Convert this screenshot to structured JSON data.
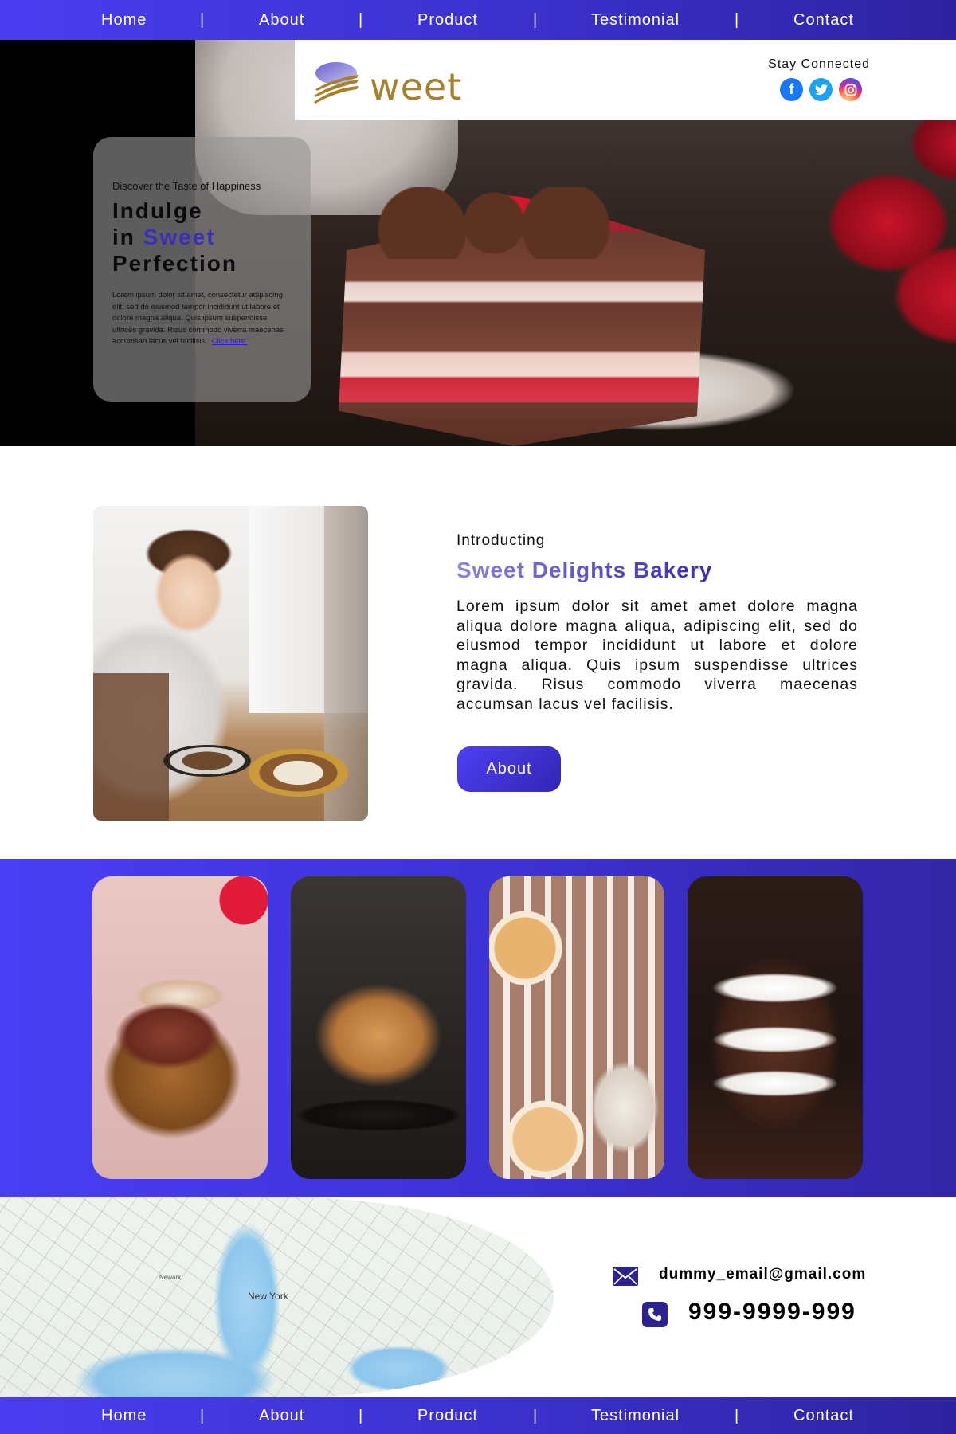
{
  "nav": {
    "items": [
      "Home",
      "About",
      "Product",
      "Testimonial",
      "Contact"
    ],
    "separator": "|"
  },
  "header": {
    "logo_text": "weet",
    "stay_connected": "Stay Connected",
    "social": [
      {
        "icon": "facebook-icon",
        "glyph": "f"
      },
      {
        "icon": "twitter-icon",
        "glyph": "t"
      },
      {
        "icon": "instagram-icon",
        "glyph": "◎"
      }
    ]
  },
  "hero": {
    "kicker": "Discover the Taste of Happiness",
    "headline_line1": "Indulge",
    "headline_in": "in",
    "headline_accent": "Sweet",
    "headline_line3": "Perfection",
    "body": "Lorem ipsum dolor sit amet, consectetur adipiscing elit, sed do eiusmod tempor incididunt ut labore et dolore magna aliqua. Quis ipsum suspendisse ultrices gravida. Risus commodo viverra maecenas accumsan lacus vel facilisis.",
    "link": "Click here."
  },
  "intro": {
    "kicker": "Introducting",
    "title": "Sweet Delights Bakery",
    "body": "Lorem ipsum dolor sit amet amet dolore magna aliqua dolore magna aliqua, adipiscing elit, sed do eiusmod tempor incididunt ut labore et dolore magna aliqua. Quis ipsum suspendisse ultrices gravida. Risus commodo viverra maecenas accumsan lacus vel facilisis.",
    "button": "About"
  },
  "gallery": {
    "tiles": [
      "cake-slice-photo",
      "bundt-cake-photo",
      "donut-cake-photo",
      "chocolate-layer-cake-photo"
    ]
  },
  "contact": {
    "map_city": "New York",
    "map_label_2": "Newark",
    "email": "dummy_email@gmail.com",
    "phone": "999-9999-999"
  },
  "colors": {
    "accent": "#3b2fb8",
    "nav_start": "#4a3df0",
    "nav_end": "#2e22a0",
    "logo_gold": "#a87f2a"
  }
}
